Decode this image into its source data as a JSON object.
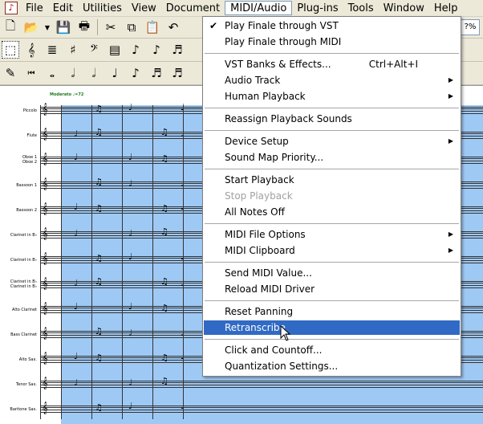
{
  "menubar": {
    "app_icon": "finale-app-icon",
    "items": [
      "File",
      "Edit",
      "Utilities",
      "View",
      "Document",
      "MIDI/Audio",
      "Plug-ins",
      "Tools",
      "Window",
      "Help"
    ],
    "open_index": 5
  },
  "toolbar": {
    "zoom_label": "?%"
  },
  "score": {
    "tempo_mark": "Moderato ♩=72",
    "instruments": [
      "Piccolo",
      "Flute",
      "Oboe 1\nOboe 2",
      "Bassoon 1",
      "Bassoon 2",
      "Clarinet in B♭",
      "Clarinet in B♭",
      "Clarinet in B♭\nClarinet in B♭",
      "Alto Clarinet",
      "Bass Clarinet",
      "Alto Sax.",
      "Tenor Sax.",
      "Baritone Sax."
    ]
  },
  "midi_menu": {
    "groups": [
      [
        {
          "label": "Play Finale through VST",
          "checked": true
        },
        {
          "label": "Play Finale through MIDI"
        }
      ],
      [
        {
          "label": "VST Banks & Effects...",
          "shortcut": "Ctrl+Alt+I"
        },
        {
          "label": "Audio Track",
          "submenu": true
        },
        {
          "label": "Human Playback",
          "submenu": true
        }
      ],
      [
        {
          "label": "Reassign Playback Sounds"
        }
      ],
      [
        {
          "label": "Device Setup",
          "submenu": true
        },
        {
          "label": "Sound Map Priority..."
        }
      ],
      [
        {
          "label": "Start Playback"
        },
        {
          "label": "Stop Playback",
          "disabled": true
        },
        {
          "label": "All Notes Off"
        }
      ],
      [
        {
          "label": "MIDI File Options",
          "submenu": true
        },
        {
          "label": "MIDI Clipboard",
          "submenu": true
        }
      ],
      [
        {
          "label": "Send MIDI Value..."
        },
        {
          "label": "Reload MIDI Driver"
        }
      ],
      [
        {
          "label": "Reset Panning"
        },
        {
          "label": "Retranscribe",
          "highlighted": true
        }
      ],
      [
        {
          "label": "Click and Countoff..."
        },
        {
          "label": "Quantization Settings..."
        }
      ]
    ]
  },
  "colors": {
    "selection": "#9ec9f5",
    "highlight": "#316ac5",
    "chrome": "#ece9d8"
  }
}
